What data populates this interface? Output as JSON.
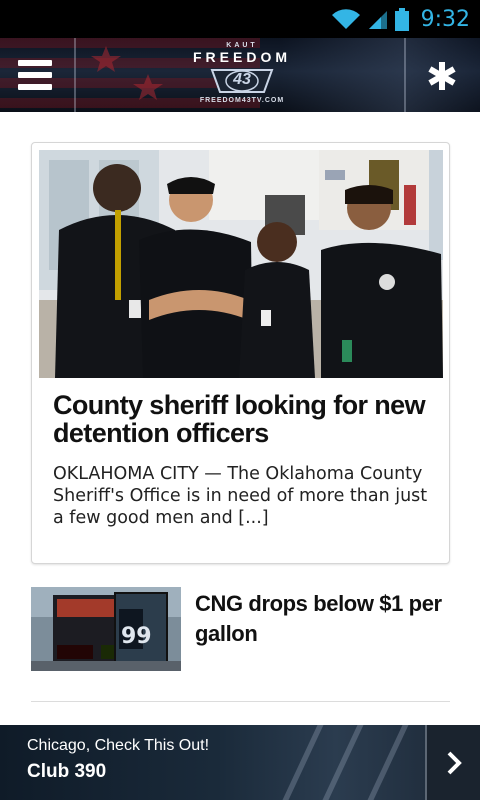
{
  "status_bar": {
    "time": "9:32",
    "icons": [
      "wifi-icon",
      "cell-signal-icon",
      "battery-icon"
    ],
    "accent_color": "#33b5e5"
  },
  "header": {
    "logo": {
      "top_text": "KAUT",
      "name": "FREEDOM",
      "number": "43",
      "url": "FREEDOM43TV.COM"
    },
    "menu_icon": "hamburger-menu-icon",
    "action_icon": "asterisk-icon"
  },
  "featured": {
    "title": "County sheriff looking for new detention officers",
    "excerpt": "OKLAHOMA CITY — The Oklahoma County Sheriff's Office is in need of more than just a few good men and [...]",
    "image": "photo of four detention officers in black uniforms"
  },
  "articles": [
    {
      "title": "CNG drops below $1 per gallon",
      "image": "gas station price sign"
    }
  ],
  "ad": {
    "line1": "Chicago, Check This Out!",
    "line2": "Club 390",
    "arrow_icon": "chevron-right-icon"
  }
}
